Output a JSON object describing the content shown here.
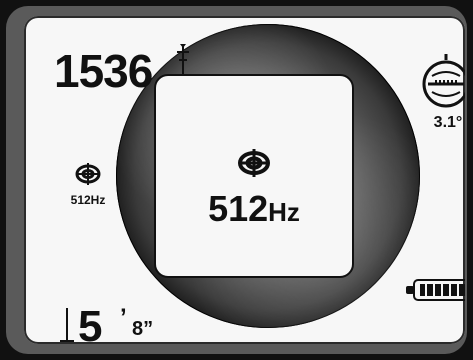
{
  "top": {
    "depth_value": "1536"
  },
  "left": {
    "frequency_label": "512Hz"
  },
  "center": {
    "frequency_value": "512",
    "frequency_unit": "Hz"
  },
  "right": {
    "pitch_value": "3.1°"
  },
  "bottom": {
    "depth_ft": "5",
    "depth_ft_mark": "’",
    "depth_in": "8”"
  },
  "colors": {
    "ink": "#111111",
    "bezel": "#111111",
    "screen": "#f7f7f7"
  }
}
